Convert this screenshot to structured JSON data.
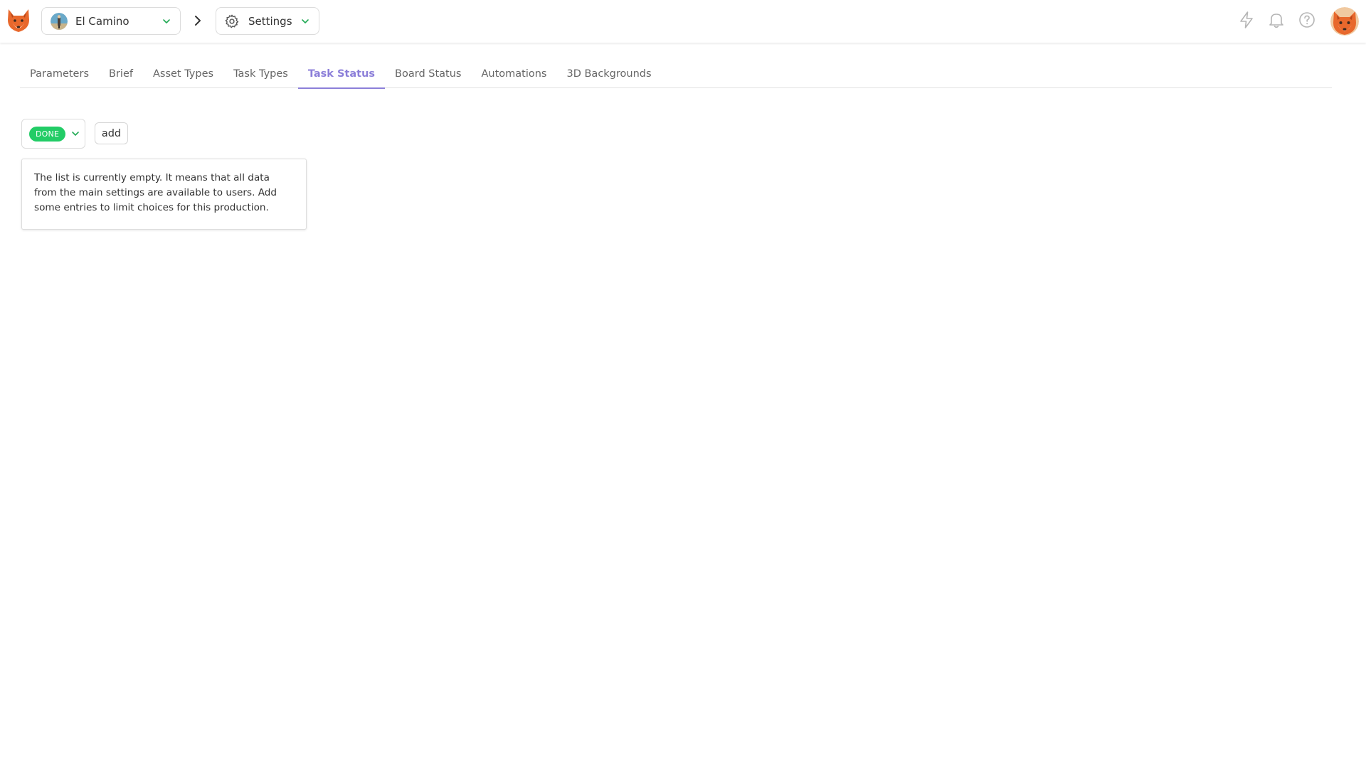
{
  "header": {
    "production": {
      "name": "El Camino",
      "avatar_icon": "production-thumbnail"
    },
    "section": {
      "label": "Settings",
      "icon": "gear-icon"
    },
    "right_icons": [
      "bolt-icon",
      "bell-icon",
      "help-icon",
      "user-avatar"
    ]
  },
  "tabs": [
    {
      "label": "Parameters",
      "active": false
    },
    {
      "label": "Brief",
      "active": false
    },
    {
      "label": "Asset Types",
      "active": false
    },
    {
      "label": "Task Types",
      "active": false
    },
    {
      "label": "Task Status",
      "active": true
    },
    {
      "label": "Board Status",
      "active": false
    },
    {
      "label": "Automations",
      "active": false
    },
    {
      "label": "3D Backgrounds",
      "active": false
    }
  ],
  "controls": {
    "status_select": {
      "value": "DONE",
      "color": "#22cc66"
    },
    "add_label": "add"
  },
  "empty_message": "The list is currently empty. It means that all data from the main settings are available to users. Add some entries to limit choices for this production.",
  "colors": {
    "accent": "#8c7fd9",
    "done": "#22cc66",
    "caret": "#22aa55",
    "logo": "#e8682c"
  }
}
